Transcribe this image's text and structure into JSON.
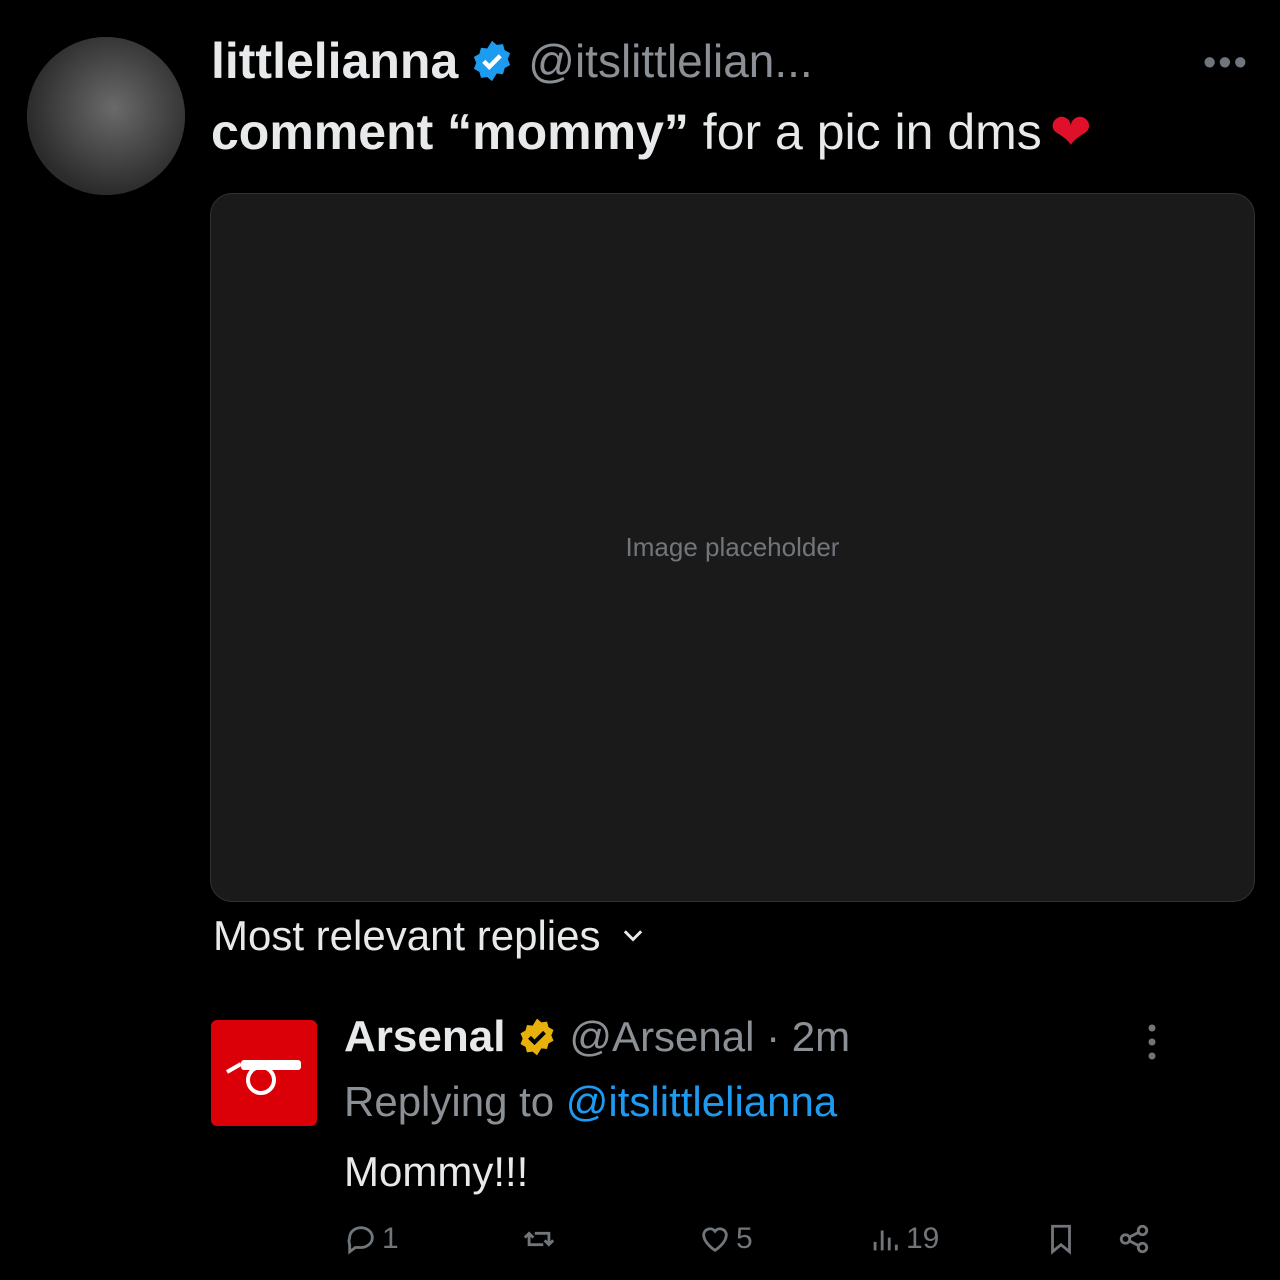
{
  "tweet": {
    "display_name": "littlelianna",
    "handle": "@itslittlelian...",
    "text_prefix": "comment ",
    "text_quoted": "“mommy”",
    "text_suffix": " for a pic in dms",
    "emoji": "❤"
  },
  "media_note": "Image placeholder",
  "replies_header": "Most relevant replies",
  "reply": {
    "display_name": "Arsenal",
    "meta": "@Arsenal · 2m",
    "replying_prefix": "Replying to ",
    "replying_handle": "@itslittlelianna",
    "text": "Mommy!!!",
    "reply_count": "1",
    "like_count": "5",
    "view_count": "19"
  },
  "colors": {
    "verified_blue": "#1d9bf0",
    "verified_gold": "#e8b00b",
    "arsenal_red": "#db0007",
    "heart": "#e0102b"
  },
  "icons": [
    "verified-badge-icon",
    "more-icon",
    "chevron-down-icon",
    "gold-badge-icon",
    "reply-icon",
    "retweet-icon",
    "like-icon",
    "views-icon",
    "bookmark-icon",
    "share-icon"
  ]
}
